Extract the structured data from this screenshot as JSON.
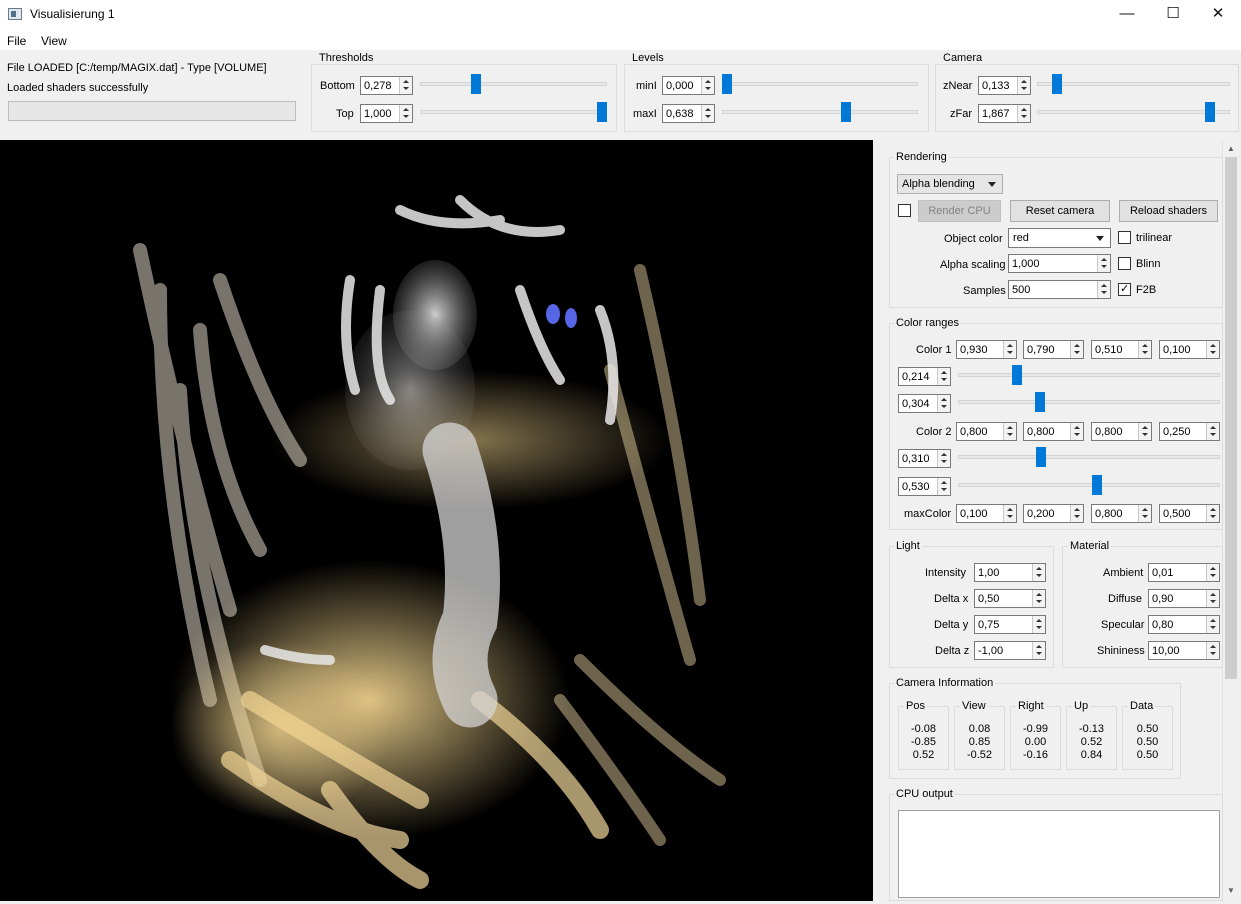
{
  "window": {
    "title": "Visualisierung 1",
    "minimize": "—",
    "maximize": "☐",
    "close": "✕"
  },
  "menu": {
    "file": "File",
    "view": "View"
  },
  "status": {
    "file_loaded": "File LOADED [C:/temp/MAGIX.dat] - Type [VOLUME]",
    "shaders": "Loaded shaders successfully",
    "progress": 0
  },
  "thresholds": {
    "title": "Thresholds",
    "bottom_label": "Bottom",
    "bottom": "0,278",
    "bottom_pos": 0.29,
    "top_label": "Top",
    "top": "1,000",
    "top_pos": 1.0
  },
  "levels": {
    "title": "Levels",
    "mini_label": "minI",
    "mini": "0,000",
    "mini_pos": 0.0,
    "maxi_label": "maxI",
    "maxi": "0,638",
    "maxi_pos": 0.638
  },
  "camera": {
    "title": "Camera",
    "znear_label": "zNear",
    "znear": "0,133",
    "znear_pos": 0.08,
    "zfar_label": "zFar",
    "zfar": "1,867",
    "zfar_pos": 0.92
  },
  "rendering": {
    "title": "Rendering",
    "mode": "Alpha blending",
    "render_cpu": "Render CPU",
    "reset_camera": "Reset camera",
    "reload_shaders": "Reload shaders",
    "object_color_label": "Object color",
    "object_color": "red",
    "alpha_scaling_label": "Alpha scaling",
    "alpha_scaling": "1,000",
    "samples_label": "Samples",
    "samples": "500",
    "trilinear": "trilinear",
    "blinn": "Blinn",
    "f2b": "F2B"
  },
  "color_ranges": {
    "title": "Color ranges",
    "color1_label": "Color 1",
    "color1": [
      "0,930",
      "0,790",
      "0,510",
      "0,100"
    ],
    "range1a": "0,214",
    "range1a_pos": 0.214,
    "range1b": "0,304",
    "range1b_pos": 0.304,
    "color2_label": "Color 2",
    "color2": [
      "0,800",
      "0,800",
      "0,800",
      "0,250"
    ],
    "range2a": "0,310",
    "range2a_pos": 0.31,
    "range2b": "0,530",
    "range2b_pos": 0.53,
    "maxcolor_label": "maxColor",
    "maxcolor": [
      "0,100",
      "0,200",
      "0,800",
      "0,500"
    ]
  },
  "light": {
    "title": "Light",
    "intensity_label": "Intensity",
    "intensity": "1,00",
    "dx_label": "Delta x",
    "dx": "0,50",
    "dy_label": "Delta y",
    "dy": "0,75",
    "dz_label": "Delta z",
    "dz": "-1,00"
  },
  "material": {
    "title": "Material",
    "ambient_label": "Ambient",
    "ambient": "0,01",
    "diffuse_label": "Diffuse",
    "diffuse": "0,90",
    "specular_label": "Specular",
    "specular": "0,80",
    "shininess_label": "Shininess",
    "shininess": "10,00"
  },
  "camera_info": {
    "title": "Camera Information",
    "columns": [
      {
        "name": "Pos",
        "values": [
          "-0.08",
          "-0.85",
          "0.52"
        ]
      },
      {
        "name": "View",
        "values": [
          "0.08",
          "0.85",
          "-0.52"
        ]
      },
      {
        "name": "Right",
        "values": [
          "-0.99",
          "0.00",
          "-0.16"
        ]
      },
      {
        "name": "Up",
        "values": [
          "-0.13",
          "0.52",
          "0.84"
        ]
      },
      {
        "name": "Data",
        "values": [
          "0.50",
          "0.50",
          "0.50"
        ]
      }
    ]
  },
  "cpu_output": {
    "title": "CPU output",
    "text": ""
  },
  "colors": {
    "accent": "#0078d7",
    "viewport_bg": "#000000",
    "volume_tint": "#f2d28c"
  }
}
